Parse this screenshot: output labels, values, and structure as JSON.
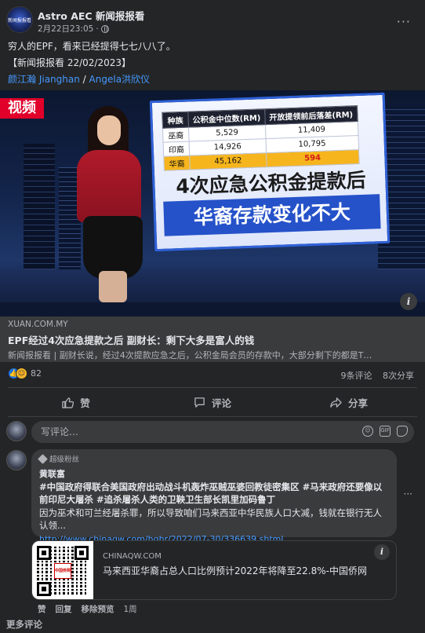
{
  "post": {
    "page_name": "Astro AEC 新闻报报看",
    "avatar_text": "新闻报报看",
    "timestamp": "2月22日23:05",
    "meta_sep": "·",
    "more_icon": "more-horizontal-icon",
    "body_line1": "穷人的EPF，看来已经提得七七八八了。",
    "body_line2": "【新闻报报看 22/02/2023】",
    "tag1": "颜江瀚 Jianghan",
    "tag_sep": "/",
    "tag2": "Angela洪欣仪"
  },
  "media": {
    "video_badge": "视频",
    "table": {
      "headers": [
        "种族",
        "公积金中位数(RM)",
        "开放提领前后落差(RM)"
      ],
      "rows": [
        [
          "巫裔",
          "5,529",
          "11,409"
        ],
        [
          "印裔",
          "14,926",
          "10,795"
        ],
        [
          "华裔",
          "45,162",
          "594"
        ]
      ]
    },
    "headline1": "4次应急公积金提款后",
    "headline2": "华裔存款变化不大"
  },
  "link": {
    "domain": "XUAN.COM.MY",
    "title": "EPF经过4次应急提款之后 副财长：剩下大多是富人的钱",
    "description": "新闻报报看 | 副财长说，经过4次提款应急之后，公积金局会员的存款中，大部分剩下的都是T…"
  },
  "summary": {
    "reaction_count": "82",
    "comments": "9条评论",
    "shares": "8次分享"
  },
  "actions": {
    "like": "赞",
    "comment": "评论",
    "share": "分享"
  },
  "comment_input": {
    "placeholder": "写评论…"
  },
  "comment": {
    "badge": "超级粉丝",
    "author": "黄联富",
    "text1": "#中国政府得联合美国政府出动战斗机轰炸巫贼巫婆回教徒密集区 #马来政府还要像以前印尼大屠杀 #追杀屠杀人类的卫鞅卫生部长凯里加码鲁丁",
    "text2": "因为巫术和可兰经屠杀罪，所以导致咱们马来西亚中华民族人口大减，钱就在银行无人认领...",
    "link": "http://www.chinaqw.com/hqhr/2022/07-30/336639.shtml",
    "preview_domain": "CHINAQW.COM",
    "preview_title": "马来西亚华裔占总人口比例预计2022年将降至22.8%-中国侨网",
    "qr_logo": "中国侨网",
    "act_like": "赞",
    "act_reply": "回复",
    "act_remove_preview": "移除预览",
    "act_time": "1周"
  },
  "more_comments": "更多评论"
}
